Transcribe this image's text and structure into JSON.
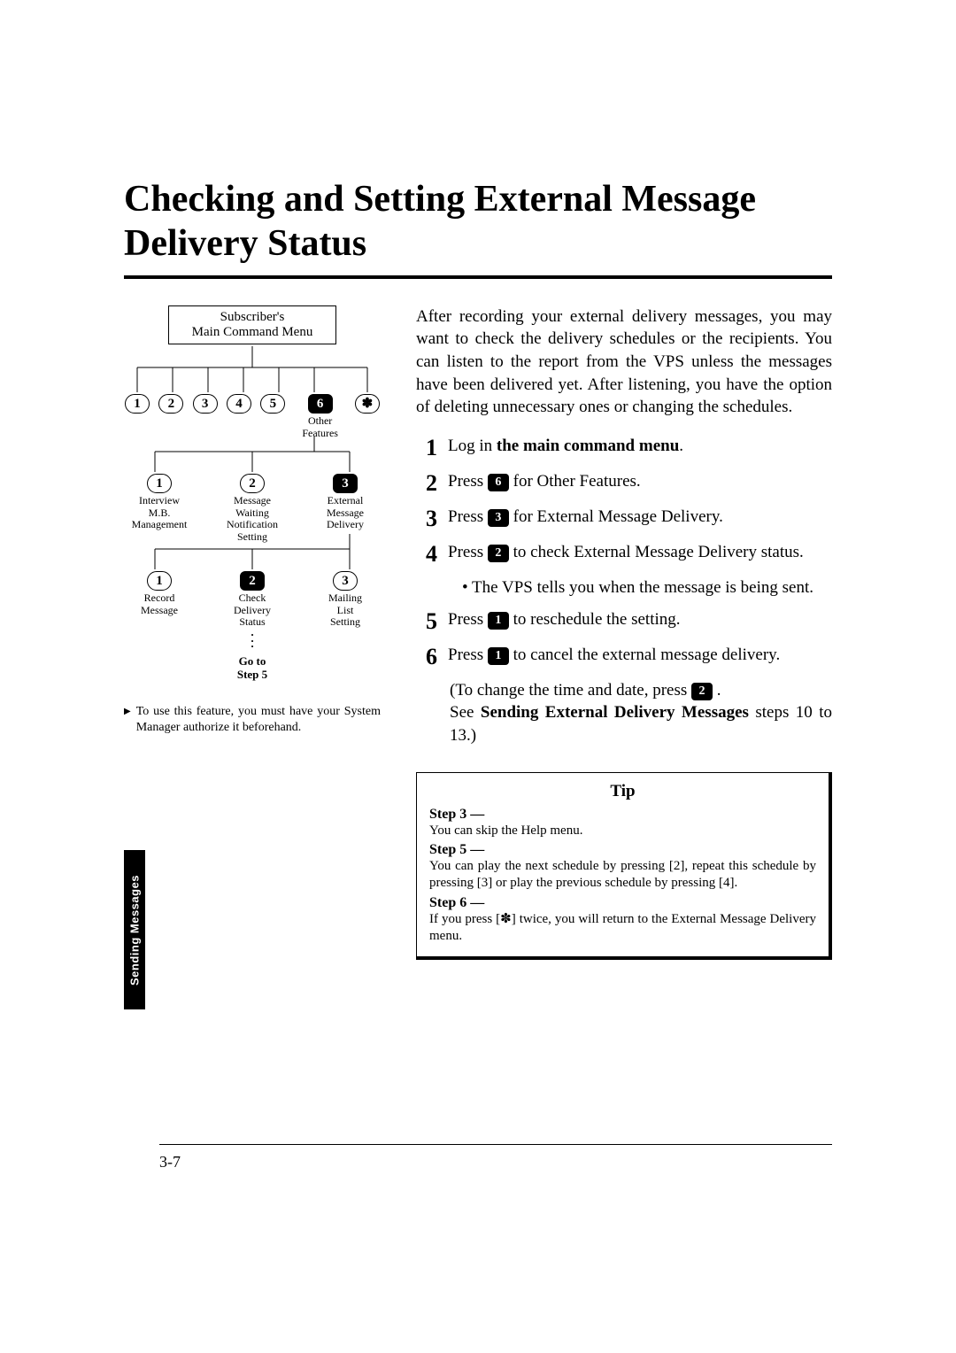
{
  "title": "Checking and Setting External Message Delivery Status",
  "side_tab": "Sending Messages",
  "page_number": "3-7",
  "diagram": {
    "menu_box_line1": "Subscriber's",
    "menu_box_line2": "Main Command Menu",
    "row1": {
      "k1": "1",
      "k2": "2",
      "k3": "3",
      "k4": "4",
      "k5": "5",
      "k6": "6",
      "kstar": "✽",
      "other_features": "Other\nFeatures"
    },
    "row2": {
      "n1": {
        "key": "1",
        "label": "Interview\nM.B.\nManagement"
      },
      "n2": {
        "key": "2",
        "label": "Message\nWaiting\nNotification\nSetting"
      },
      "n3": {
        "key": "3",
        "label": "External\nMessage\nDelivery"
      }
    },
    "row3": {
      "n1": {
        "key": "1",
        "label": "Record\nMessage"
      },
      "n2": {
        "key": "2",
        "label": "Check\nDelivery\nStatus",
        "goto": "Go to\nStep 5"
      },
      "n3": {
        "key": "3",
        "label": "Mailing\nList\nSetting"
      }
    }
  },
  "note": "To use this feature, you must have your System Manager authorize it beforehand.",
  "intro": "After recording your external delivery messages, you may want to check the delivery schedules or the recipients. You can listen to the report from the VPS unless the messages have been delivered yet. After listening, you have the option of deleting unnecessary ones or changing the schedules.",
  "steps": [
    {
      "n": "1",
      "pre": "Log in ",
      "bold": "the main command menu",
      "post": "."
    },
    {
      "n": "2",
      "pre": "Press ",
      "key": "6",
      "post": " for Other Features."
    },
    {
      "n": "3",
      "pre": "Press ",
      "key": "3",
      "post": " for External Message Delivery."
    },
    {
      "n": "4",
      "pre": "Press ",
      "key": "2",
      "post": " to check External Message Delivery status."
    },
    {
      "n": "5",
      "pre": "Press ",
      "key": "1",
      "post": " to reschedule the setting."
    },
    {
      "n": "6",
      "pre": "Press ",
      "key": "1",
      "post": " to cancel the external message delivery."
    }
  ],
  "sub4": "• The VPS tells you when the message is being sent.",
  "sub6_a_pre": "(To change the time and date, press ",
  "sub6_a_key": "2",
  "sub6_a_post": " .",
  "sub6_b_pre": "See ",
  "sub6_b_bold": "Sending External Delivery Messages",
  "sub6_b_post": " steps 10 to 13.)",
  "tip": {
    "title": "Tip",
    "s3_h": "Step 3 —",
    "s3_t": "You can skip the Help menu.",
    "s5_h": "Step 5 —",
    "s5_t": "You can play the next schedule by pressing [2], repeat this schedule by pressing [3] or play the previous schedule by pressing [4].",
    "s6_h": "Step 6 —",
    "s6_t": "If you press [✽] twice, you will return to the External Message Delivery menu."
  }
}
